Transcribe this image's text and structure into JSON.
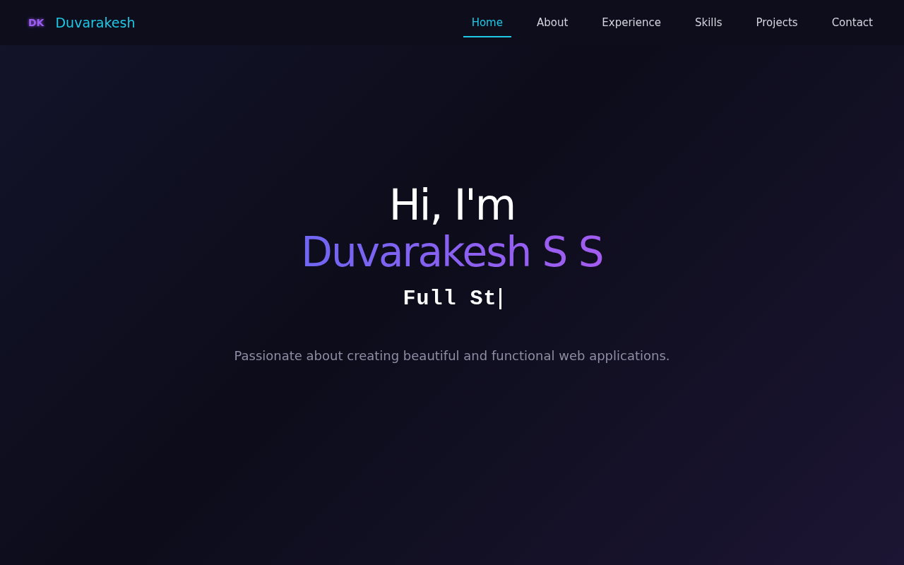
{
  "navbar": {
    "logo": "DK",
    "brand": "Duvarakesh",
    "links": [
      {
        "label": "Home",
        "selected": true
      },
      {
        "label": "About",
        "selected": false
      },
      {
        "label": "Experience",
        "selected": false
      },
      {
        "label": "Skills",
        "selected": false
      },
      {
        "label": "Projects",
        "selected": false
      },
      {
        "label": "Contact",
        "selected": false
      }
    ]
  },
  "hero": {
    "greeting": "Hi, I'm",
    "name": "Duvarakesh S S",
    "typed_text": "Full St",
    "tagline": "Passionate about creating beautiful and functional web applications."
  }
}
